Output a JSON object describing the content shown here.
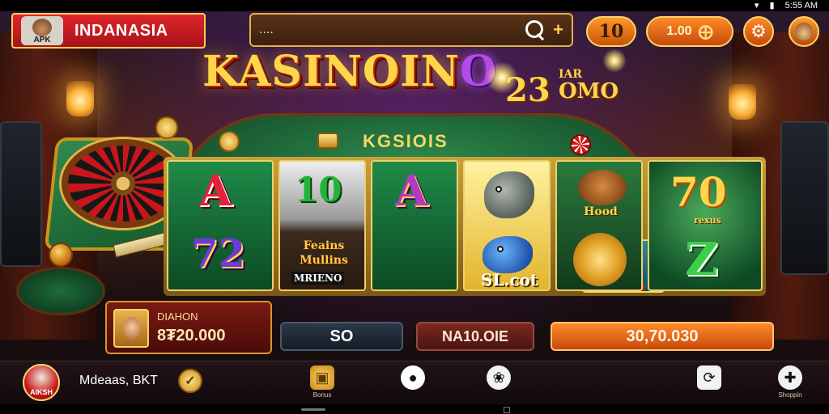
{
  "status_bar": {
    "time": "5:55 AM"
  },
  "header": {
    "brand_badge": "APK",
    "brand_name": "INDANASIA",
    "search": {
      "placeholder": "....",
      "value": ""
    },
    "coins": "10",
    "balance": "1.00"
  },
  "hero": {
    "title_part1": "KASINO",
    "title_part2": "IN",
    "title_part3": "O",
    "subtitle_number": "23",
    "subtitle_small": "IAR",
    "subtitle_word": "OMO",
    "table_label": "KGSIOIS"
  },
  "reels": {
    "r1_top": "A",
    "r1_bottom": "72",
    "r2_top": "10",
    "r2_feature_line1": "Feains",
    "r2_feature_line2": "Mullins",
    "r2_feature_tag": "MRIENO",
    "r3_top": "A",
    "r4_bottom": "SL.cot",
    "r5_caption": "Hood",
    "r6_top": "70",
    "r6_caption": "rexus",
    "r6_bottom": "Z"
  },
  "player": {
    "name": "DIAHON",
    "amount": "8₮20.000"
  },
  "controls": {
    "bet": "SO",
    "win": "NA10.OIE",
    "spin_total": "30,70.030"
  },
  "nav": {
    "avatar_label": "AIKSH",
    "user_name": "Mdeaas, BKT",
    "item1_label": "Bonus",
    "item5_label": "Shoppin"
  },
  "colors": {
    "accent": "#ff8a28",
    "gold": "#ffd54a",
    "felt": "#1f8a48",
    "brand_red": "#d01a1a"
  }
}
